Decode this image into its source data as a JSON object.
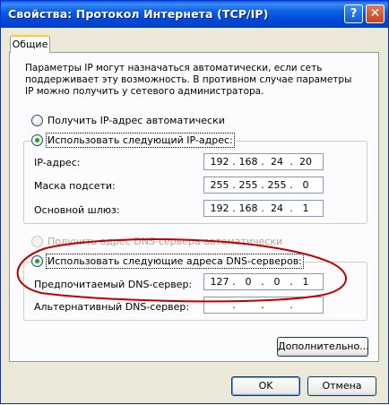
{
  "window": {
    "title": "Свойства: Протокол Интернета (TCP/IP)",
    "help_glyph": "?",
    "close_glyph": "✕"
  },
  "tabs": [
    {
      "label": "Общие"
    }
  ],
  "description": "Параметры IP могут назначаться автоматически, если сеть поддерживает эту возможность. В противном случае параметры IP можно получить у сетевого администратора.",
  "ip_section": {
    "auto_option": {
      "label": "Получить IP-адрес автоматически",
      "selected": false
    },
    "manual_option": {
      "label": "Использовать следующий IP-адрес:",
      "selected": true
    },
    "fields": [
      {
        "label": "IP-адрес:",
        "octets": [
          "192",
          "168",
          "24",
          "20"
        ]
      },
      {
        "label": "Маска подсети:",
        "octets": [
          "255",
          "255",
          "255",
          "0"
        ]
      },
      {
        "label": "Основной шлюз:",
        "octets": [
          "192",
          "168",
          "24",
          "1"
        ]
      }
    ]
  },
  "dns_section": {
    "auto_option": {
      "label": "Получить адрес DNS-сервера автоматически",
      "selected": false,
      "disabled": true
    },
    "manual_option": {
      "label": "Использовать следующие адреса DNS-серверов:",
      "selected": true
    },
    "fields": [
      {
        "label": "Предпочитаемый DNS-сервер:",
        "octets": [
          "127",
          "0",
          "0",
          "1"
        ]
      },
      {
        "label": "Альтернативный DNS-сервер:",
        "octets": [
          "",
          "",
          "",
          ""
        ]
      }
    ]
  },
  "buttons": {
    "advanced": "Дополнительно...",
    "ok": "OK",
    "cancel": "Отмена"
  },
  "colors": {
    "titlebar": "#0a5fe8",
    "dialog_bg": "#ece9d8",
    "annotation": "#c00000",
    "radio_dot": "#21a121"
  }
}
